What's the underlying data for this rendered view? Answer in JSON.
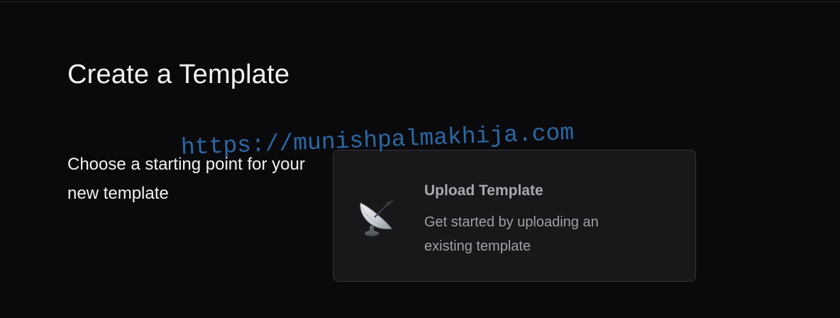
{
  "page": {
    "title": "Create a Template",
    "subtitle": "Choose a starting point for your new template"
  },
  "upload_card": {
    "icon": "satellite-dish-icon",
    "title": "Upload Template",
    "description": "Get started by uploading an existing template"
  },
  "watermark": {
    "text": "https://munishpalmakhija.com"
  },
  "colors": {
    "background": "#0a0a0d",
    "card_background": "#18181b",
    "card_border": "#33333a",
    "watermark": "#2f6fb0"
  }
}
